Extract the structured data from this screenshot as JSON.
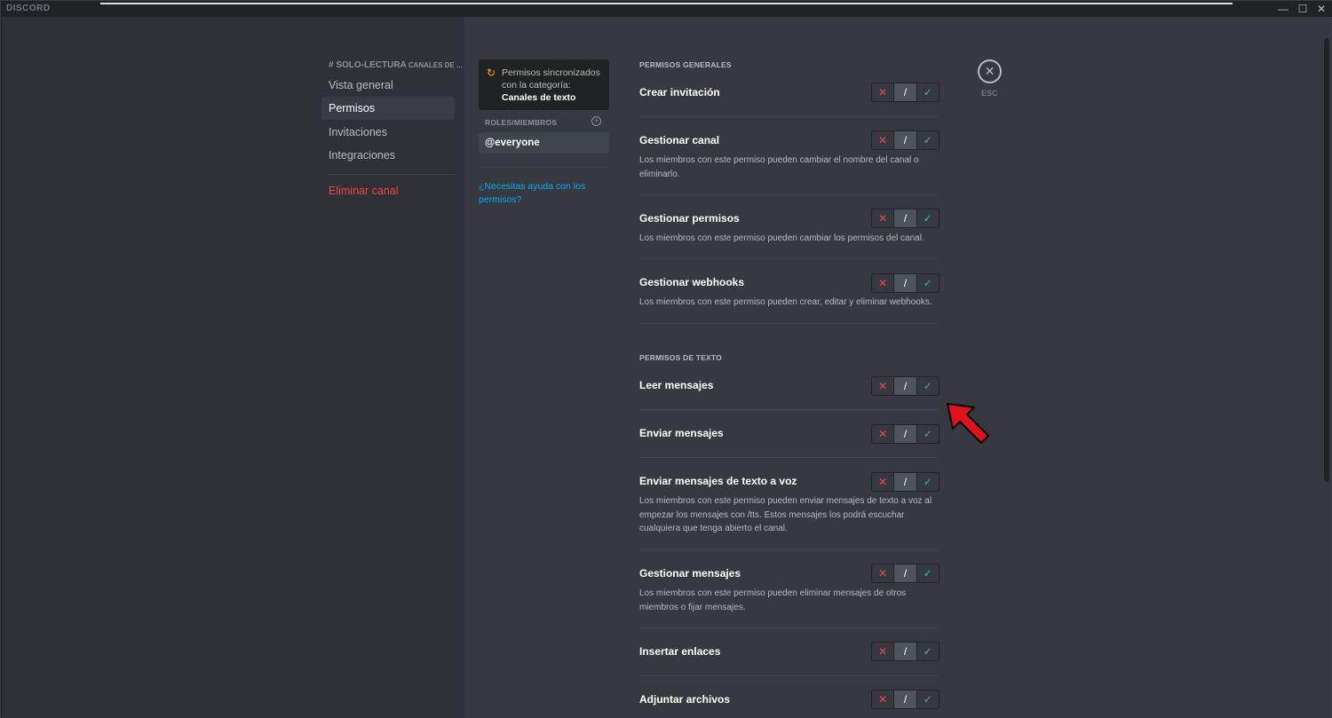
{
  "titlebar": {
    "brand": "DISCORD",
    "minimize": "—",
    "maximize": "☐",
    "close": "✕"
  },
  "sidebar": {
    "header": "# SOLO-LECTURA",
    "header_sub": "CANALES DE ...",
    "items": [
      {
        "label": "Vista general"
      },
      {
        "label": "Permisos"
      },
      {
        "label": "Invitaciones"
      },
      {
        "label": "Integraciones"
      }
    ],
    "danger_item": "Eliminar canal"
  },
  "roles": {
    "sync_text": "Permisos sincronizados con la categoría:",
    "sync_category": "Canales de texto",
    "label": "ROLES/MIEMBROS",
    "add": "+",
    "items": [
      "@everyone"
    ],
    "help": "¿Necesitas ayuda con los permisos?"
  },
  "toggle": {
    "deny": "✕",
    "neutral": "/",
    "allow": "✓"
  },
  "sections": [
    "PERMISOS GENERALES",
    "PERMISOS DE TEXTO"
  ],
  "permissions": [
    {
      "name": "Crear invitación",
      "desc": ""
    },
    {
      "name": "Gestionar canal",
      "desc": "Los miembros con este permiso pueden cambiar el nombre del canal o eliminarlo."
    },
    {
      "name": "Gestionar permisos",
      "desc": "Los miembros con este permiso pueden cambiar los permisos del canal."
    },
    {
      "name": "Gestionar webhooks",
      "desc": "Los miembros con este permiso pueden crear, editar y eliminar webhooks."
    },
    {
      "name": "Leer mensajes",
      "desc": ""
    },
    {
      "name": "Enviar mensajes",
      "desc": ""
    },
    {
      "name": "Enviar mensajes de texto a voz",
      "desc": "Los miembros con este permiso pueden enviar mensajes de texto a voz al empezar los mensajes con /tts. Estos mensajes los podrá escuchar cualquiera que tenga abierto el canal."
    },
    {
      "name": "Gestionar mensajes",
      "desc": "Los miembros con este permiso pueden eliminar mensajes de otros miembros o fijar mensajes."
    },
    {
      "name": "Insertar enlaces",
      "desc": ""
    },
    {
      "name": "Adjuntar archivos",
      "desc": ""
    }
  ],
  "esc": {
    "icon": "✕",
    "label": "ESC"
  },
  "colors": {
    "deny": "#f04747",
    "allow": "#43b581",
    "link": "#00b0f4",
    "annotation_arrow": "#e3111b"
  }
}
